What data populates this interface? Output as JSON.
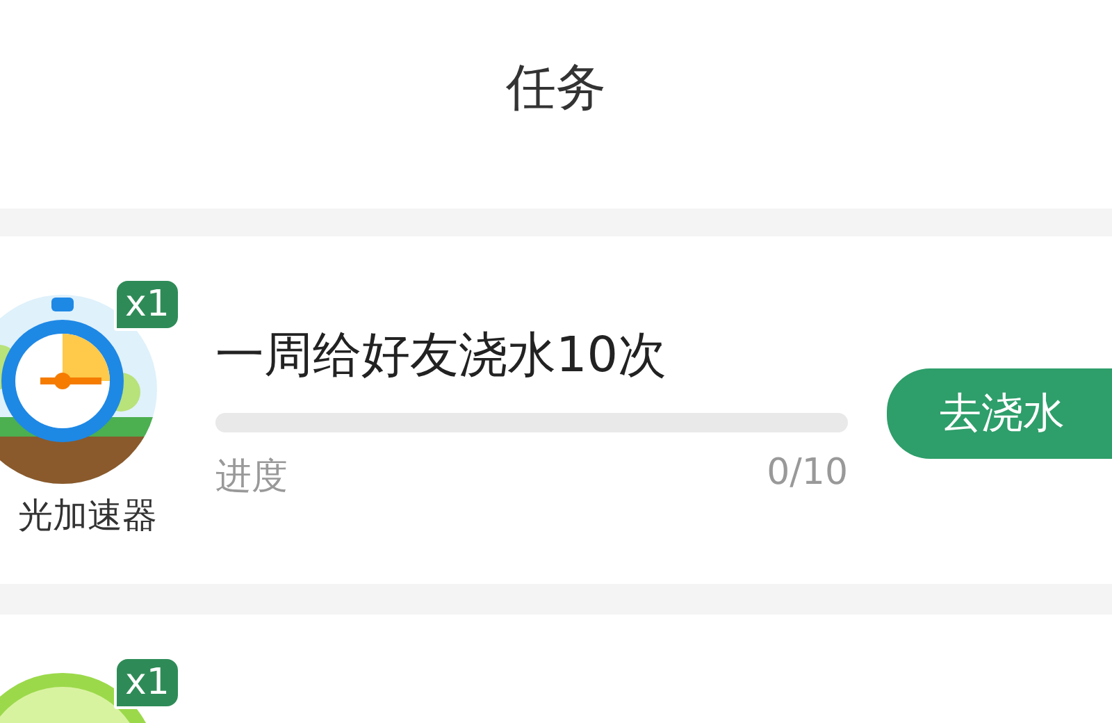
{
  "header": {
    "title": "任务"
  },
  "tasks": [
    {
      "kind": "stopwatch",
      "badge": "x1",
      "reward_label": "光加速器",
      "title": "一周给好友浇水10次",
      "progress_label": "进度",
      "progress_text": "0/10",
      "level": 0,
      "button": "去浇水"
    },
    {
      "kind": "fruit",
      "badge": "x1"
    }
  ]
}
